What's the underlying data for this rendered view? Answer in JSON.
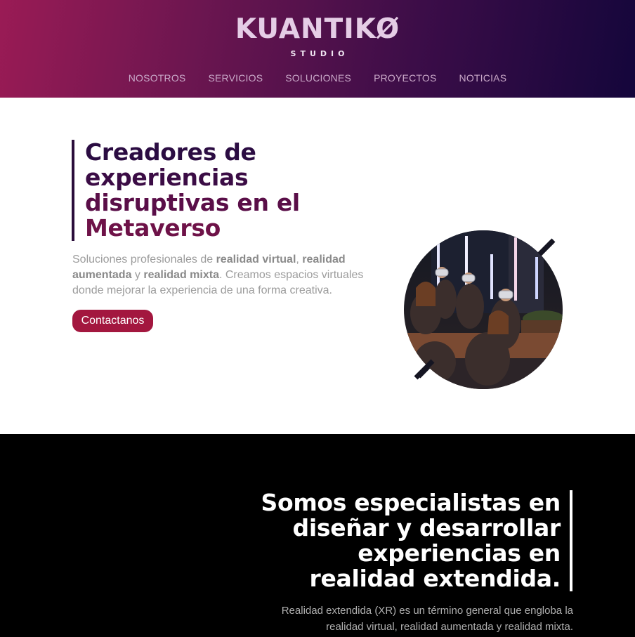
{
  "header": {
    "logo": "KUANTIKØ",
    "logo_sub": "STUDIO",
    "nav": [
      "NOSOTROS",
      "SERVICIOS",
      "SOLUCIONES",
      "PROYECTOS",
      "NOTICIAS"
    ]
  },
  "hero": {
    "title_lines": [
      "Creadores de",
      "experiencias",
      "disruptivas en el",
      "Metaverso"
    ],
    "desc": {
      "t1": "Soluciones profesionales de ",
      "b1": "realidad virtual",
      "t2": ", ",
      "b2": "realidad aumentada",
      "t3": " y ",
      "b3": "realidad mixta",
      "t4": ". Creamos espacios virtuales donde mejorar la experiencia de una forma creativa."
    },
    "cta": "Contactanos"
  },
  "specialists": {
    "title_lines": [
      "Somos especialistas en",
      "diseñar y desarrollar",
      "experiencias en",
      "realidad extendida."
    ],
    "desc_lines": [
      "Realidad extendida (XR) es un término general que engloba la",
      "realidad virtual, realidad aumentada y realidad mixta."
    ]
  },
  "colors": {
    "accent": "#a3173f",
    "header_start": "#9a1b55",
    "header_end": "#14063b",
    "title_dark": "#2b0c42"
  }
}
